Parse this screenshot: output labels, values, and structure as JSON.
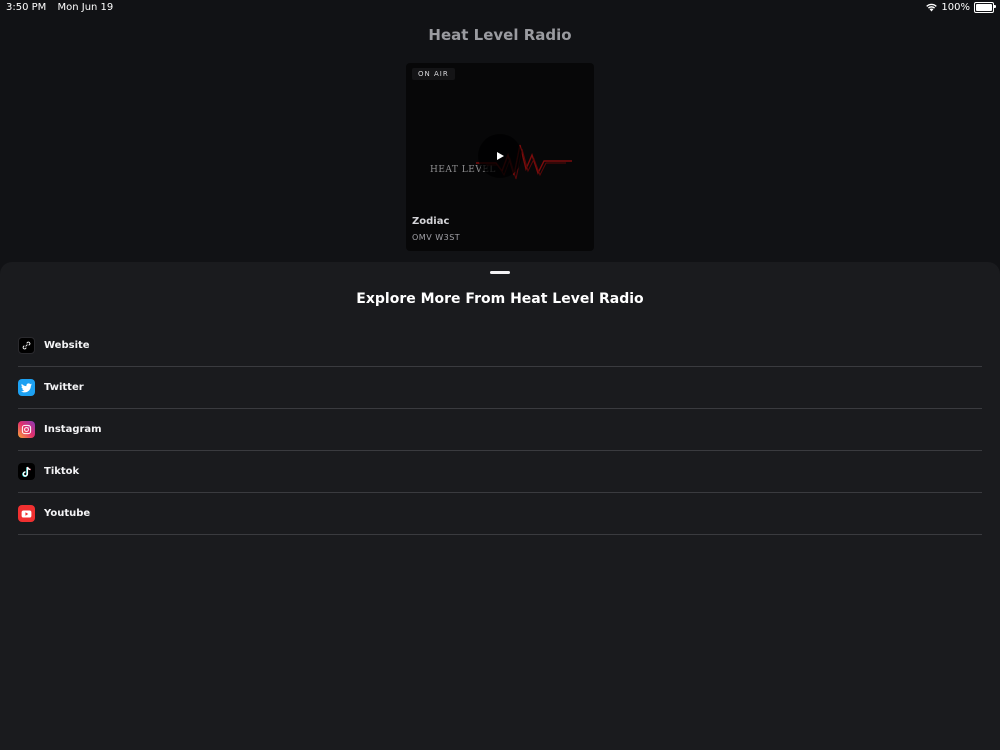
{
  "status_bar": {
    "time": "3:50 PM",
    "date": "Mon Jun 19",
    "battery": "100%",
    "battery_level": 1.0
  },
  "header": {
    "title": "Heat Level Radio"
  },
  "player": {
    "badge": "ON AIR",
    "artwork_text": "HEAT LEVEL",
    "track_title": "Zodiac",
    "track_artist": "OMV W3ST",
    "play_icon": "play-icon"
  },
  "sheet": {
    "title": "Explore More From Heat Level Radio",
    "links": [
      {
        "label": "Website",
        "icon": "link-icon",
        "color": "#000000"
      },
      {
        "label": "Twitter",
        "icon": "twitter-icon",
        "color": "#1da1f2"
      },
      {
        "label": "Instagram",
        "icon": "instagram-icon",
        "color": "#d62976"
      },
      {
        "label": "Tiktok",
        "icon": "tiktok-icon",
        "color": "#000000"
      },
      {
        "label": "Youtube",
        "icon": "youtube-icon",
        "color": "#f03030"
      }
    ]
  }
}
